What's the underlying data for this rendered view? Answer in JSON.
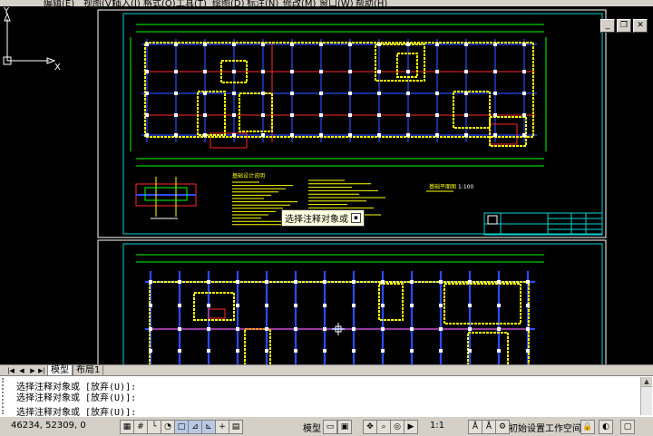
{
  "menu": {
    "items": [
      "编辑(E)",
      "视图(V)",
      "插入(I)",
      "格式(O)",
      "工具(T)",
      "绘图(D)",
      "标注(N)",
      "修改(M)",
      "窗口(W)",
      "帮助(H)"
    ]
  },
  "window_buttons": {
    "minimize": "_",
    "restore": "❐",
    "close": "✕"
  },
  "drawing": {
    "upper_title": "基础平面图",
    "upper_scale": "1:100",
    "notes_title": "基础设计说明"
  },
  "tooltip": {
    "text": "选择注释对象或"
  },
  "ucs": {
    "y_label": "Y",
    "x_label": "X"
  },
  "tabs": {
    "nav": [
      "|◀",
      "◀",
      "▶",
      "▶|"
    ],
    "model": "模型",
    "layout1": "布局1"
  },
  "command": {
    "lines": [
      "选择注释对象或 [放弃(U)]:",
      "选择注释对象或 [放弃(U)]:",
      "选择注释对象或 [放弃(U)]:"
    ]
  },
  "status": {
    "coordinates": "46234, 52309, 0",
    "model_label": "模型",
    "annotation_scale": "1:1",
    "workspace": "初始设置工作空间"
  },
  "colors": {
    "yellow": "#ffff00",
    "blue": "#2b4bff",
    "red": "#ff2a2a",
    "cyan": "#00d5d5",
    "green": "#00ff00",
    "white": "#ffffff"
  }
}
